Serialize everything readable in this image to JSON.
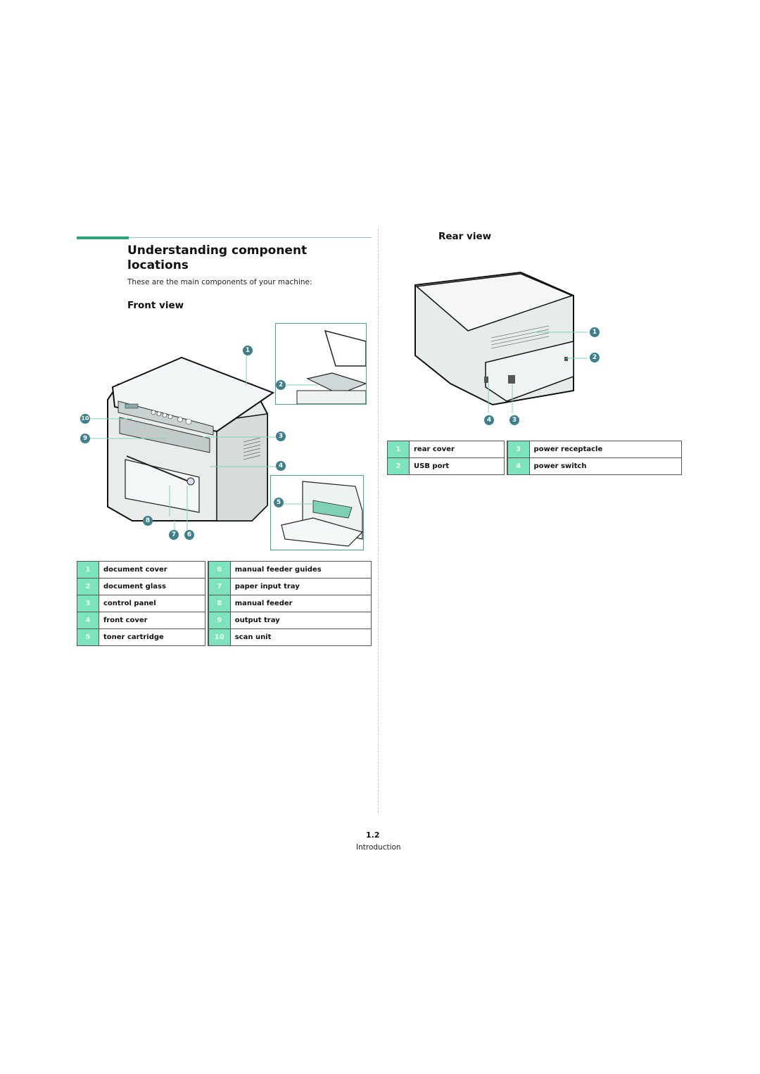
{
  "heading": {
    "title": "Understanding component locations",
    "intro": "These are the main components of your machine:"
  },
  "front_view": {
    "title": "Front view",
    "callouts": [
      "1",
      "2",
      "3",
      "4",
      "5",
      "6",
      "7",
      "8",
      "9",
      "10"
    ],
    "table": [
      {
        "num": "1",
        "label": "document cover"
      },
      {
        "num": "2",
        "label": "document glass"
      },
      {
        "num": "3",
        "label": "control panel"
      },
      {
        "num": "4",
        "label": "front cover"
      },
      {
        "num": "5",
        "label": "toner cartridge"
      },
      {
        "num": "6",
        "label": "manual feeder guides"
      },
      {
        "num": "7",
        "label": "paper input tray"
      },
      {
        "num": "8",
        "label": "manual feeder"
      },
      {
        "num": "9",
        "label": "output tray"
      },
      {
        "num": "10",
        "label": "scan unit"
      }
    ]
  },
  "rear_view": {
    "title": "Rear view",
    "callouts": [
      "1",
      "2",
      "3",
      "4"
    ],
    "table": [
      {
        "num": "1",
        "label": "rear cover"
      },
      {
        "num": "2",
        "label": "USB port"
      },
      {
        "num": "3",
        "label": "power receptacle"
      },
      {
        "num": "4",
        "label": "power switch"
      }
    ]
  },
  "footer": {
    "page_number": "1.2",
    "section": "Introduction"
  },
  "colors": {
    "accent": "#2aa57a",
    "table_number_bg": "#7de3bd",
    "callout": "#3f7f8c"
  }
}
